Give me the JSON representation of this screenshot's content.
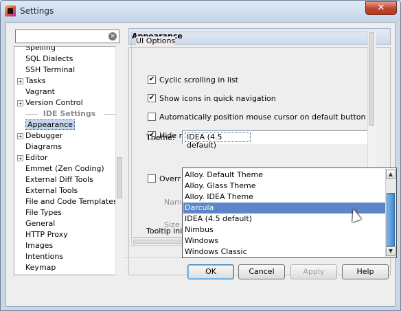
{
  "window": {
    "title": "Settings",
    "close_glyph": "✕"
  },
  "search": {
    "value": "",
    "clear_icon": "clear-icon"
  },
  "tree": {
    "items_top": [
      {
        "label": "Spelling",
        "expandable": false
      },
      {
        "label": "SQL Dialects",
        "expandable": false
      },
      {
        "label": "SSH Terminal",
        "expandable": false
      },
      {
        "label": "Tasks",
        "expandable": true
      },
      {
        "label": "Vagrant",
        "expandable": false
      },
      {
        "label": "Version Control",
        "expandable": true
      }
    ],
    "section_header": "IDE Settings",
    "items_ide": [
      {
        "label": "Appearance",
        "expandable": false,
        "selected": true
      },
      {
        "label": "Debugger",
        "expandable": true
      },
      {
        "label": "Diagrams",
        "expandable": false
      },
      {
        "label": "Editor",
        "expandable": true
      },
      {
        "label": "Emmet (Zen Coding)",
        "expandable": false
      },
      {
        "label": "External Diff Tools",
        "expandable": false
      },
      {
        "label": "External Tools",
        "expandable": false
      },
      {
        "label": "File and Code Templates",
        "expandable": false
      },
      {
        "label": "File Types",
        "expandable": false
      },
      {
        "label": "General",
        "expandable": false
      },
      {
        "label": "HTTP Proxy",
        "expandable": false
      },
      {
        "label": "Images",
        "expandable": false
      },
      {
        "label": "Intentions",
        "expandable": false
      },
      {
        "label": "Keymap",
        "expandable": false
      }
    ]
  },
  "panel": {
    "title": "Appearance",
    "group_title": "UI Options",
    "options": [
      {
        "label": "Cyclic scrolling in list",
        "checked": true
      },
      {
        "label": "Show icons in quick navigation",
        "checked": true
      },
      {
        "label": "Automatically position mouse cursor on default button",
        "checked": false
      },
      {
        "label": "Hide navigation popups on focus loss",
        "checked": true
      }
    ],
    "theme_label": "Theme:",
    "theme_value": "IDEA (4.5 default)",
    "override_label": "Overr",
    "override_checked": false,
    "name_label": "Name",
    "size_label": "Size:",
    "tooltip_label": "Tooltip ini"
  },
  "theme_dropdown": {
    "options": [
      "Alloy. Default Theme",
      "Alloy. Glass Theme",
      "Alloy. IDEA Theme",
      "Darcula",
      "IDEA (4.5 default)",
      "Nimbus",
      "Windows",
      "Windows Classic"
    ],
    "highlighted": "Darcula"
  },
  "buttons": {
    "ok": "OK",
    "cancel": "Cancel",
    "apply": "Apply",
    "help": "Help"
  },
  "colors": {
    "selection": "#5d86c8",
    "title_bar": "#c4d4e8",
    "close": "#c0462f"
  }
}
